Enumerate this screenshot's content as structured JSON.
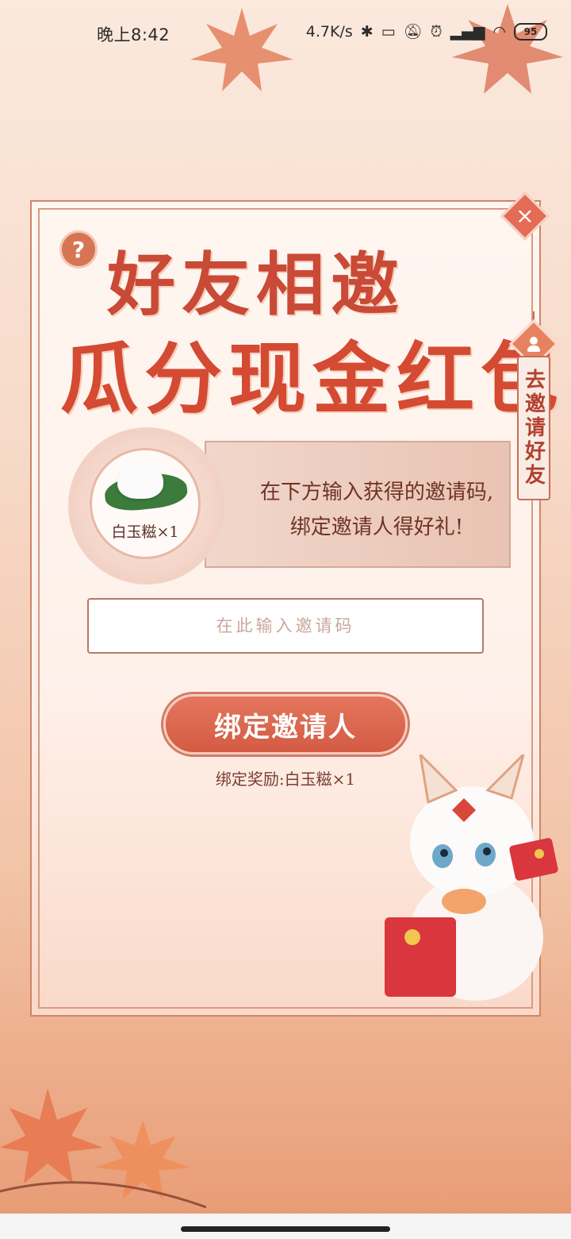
{
  "status_bar": {
    "time": "晚上8:42",
    "network_speed": "4.7K/s",
    "battery": "95"
  },
  "modal": {
    "title_line1": "好友相邀",
    "title_line2": "瓜分现金红包",
    "help_symbol": "?",
    "close_symbol": "×",
    "invite_tab_label": "去邀请好友",
    "reward": {
      "item_label": "白玉糍×1",
      "description_line1": "在下方输入获得的邀请码,",
      "description_line2": "绑定邀请人得好礼!"
    },
    "code_input": {
      "value": "",
      "placeholder": "在此输入邀请码"
    },
    "bind_button_label": "绑定邀请人",
    "bind_reward_text": "绑定奖励:白玉糍×1"
  },
  "colors": {
    "accent": "#d35b43",
    "frame": "#cf8469",
    "title": "#c94a36"
  }
}
